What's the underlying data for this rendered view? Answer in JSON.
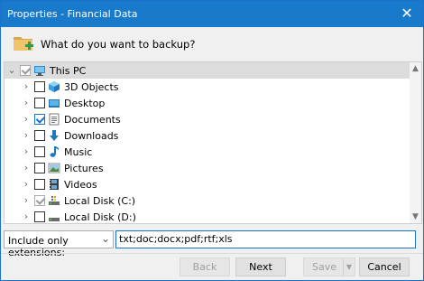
{
  "window": {
    "title": "Properties - Financial Data"
  },
  "header": {
    "question": "What do you want to backup?"
  },
  "tree": {
    "items": [
      {
        "label": "This PC",
        "icon": "computer-icon",
        "checked": "grey",
        "expanded": true,
        "selected": true
      },
      {
        "label": "3D Objects",
        "icon": "3d-objects-icon",
        "checked": "none"
      },
      {
        "label": "Desktop",
        "icon": "desktop-icon",
        "checked": "none"
      },
      {
        "label": "Documents",
        "icon": "documents-icon",
        "checked": "checked"
      },
      {
        "label": "Downloads",
        "icon": "downloads-icon",
        "checked": "none"
      },
      {
        "label": "Music",
        "icon": "music-icon",
        "checked": "none"
      },
      {
        "label": "Pictures",
        "icon": "pictures-icon",
        "checked": "none"
      },
      {
        "label": "Videos",
        "icon": "videos-icon",
        "checked": "none"
      },
      {
        "label": "Local Disk (C:)",
        "icon": "drive-c-icon",
        "checked": "grey"
      },
      {
        "label": "Local Disk (D:)",
        "icon": "drive-d-icon",
        "checked": "none"
      }
    ]
  },
  "filter": {
    "mode": "Include only extensions:",
    "extensions": "txt;doc;docx;pdf;rtf;xls"
  },
  "buttons": {
    "back": "Back",
    "next": "Next",
    "save": "Save",
    "cancel": "Cancel"
  },
  "colors": {
    "titlebar": "#1979ca",
    "accent": "#1a73c9"
  }
}
